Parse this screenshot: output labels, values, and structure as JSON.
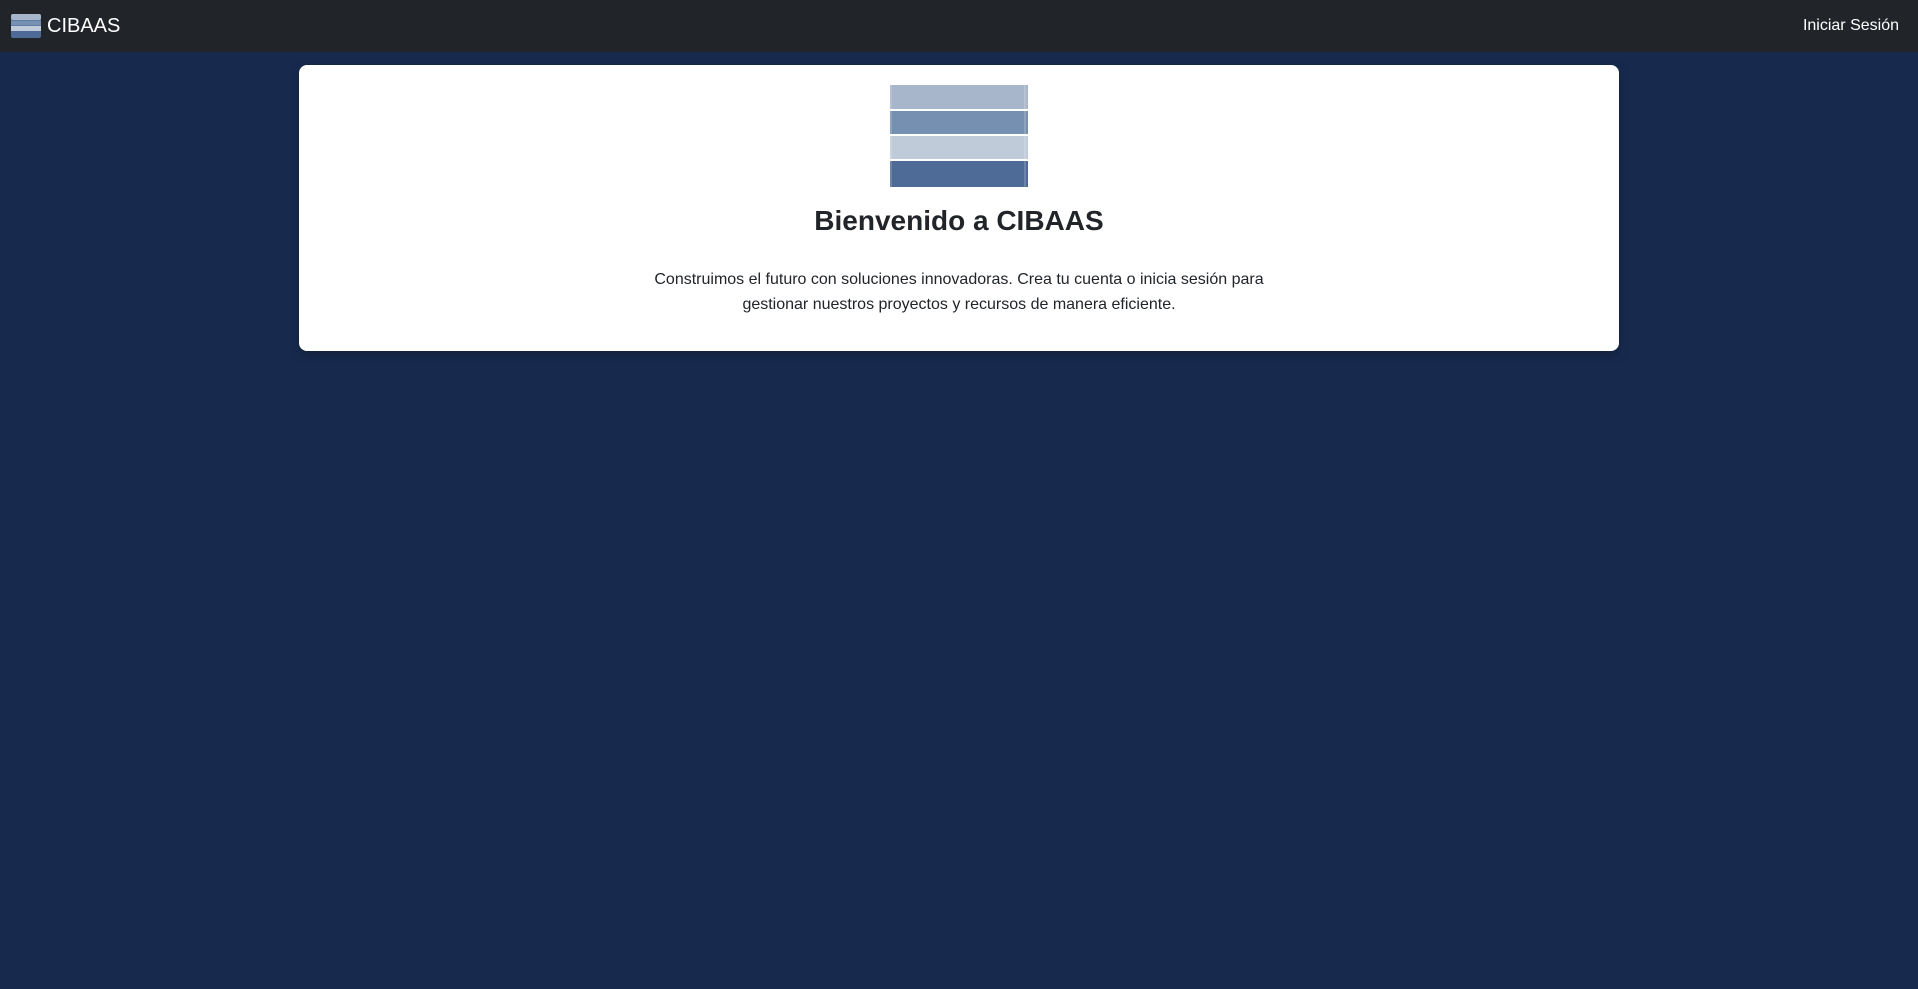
{
  "navbar": {
    "brand_name": "CIBAAS",
    "login_label": "Iniciar Sesión"
  },
  "hero": {
    "title": "Bienvenido a CIBAAS",
    "description": "Construimos el futuro con soluciones innovadoras. Crea tu cuenta o inicia sesión para gestionar nuestros proyectos y recursos de manera eficiente."
  },
  "colors": {
    "page_background": "#172a4e",
    "navbar_background": "#212529",
    "card_background": "#ffffff",
    "logo_stripe_1": "#a7b6ca",
    "logo_stripe_2": "#7590b1",
    "logo_stripe_3": "#bfcbd9",
    "logo_stripe_4": "#4d6b96"
  }
}
